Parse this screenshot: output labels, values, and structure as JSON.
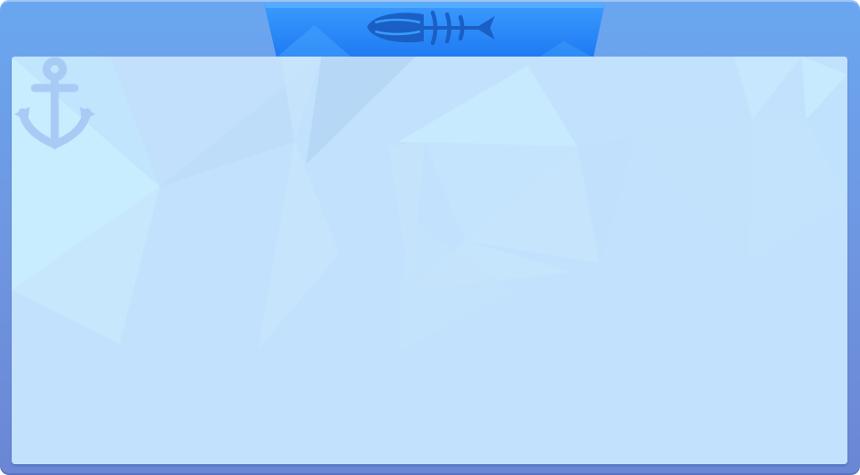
{
  "theme": {
    "frame_color": "#6f95e0",
    "tab_color": "#2f8cff",
    "panel_color": "#c4e2fd",
    "emblem_color": "#1f67c9",
    "anchor_color": "#a9cdf7"
  },
  "icons": {
    "header_emblem": "fish-skeleton-icon",
    "watermark": "anchor-icon"
  }
}
